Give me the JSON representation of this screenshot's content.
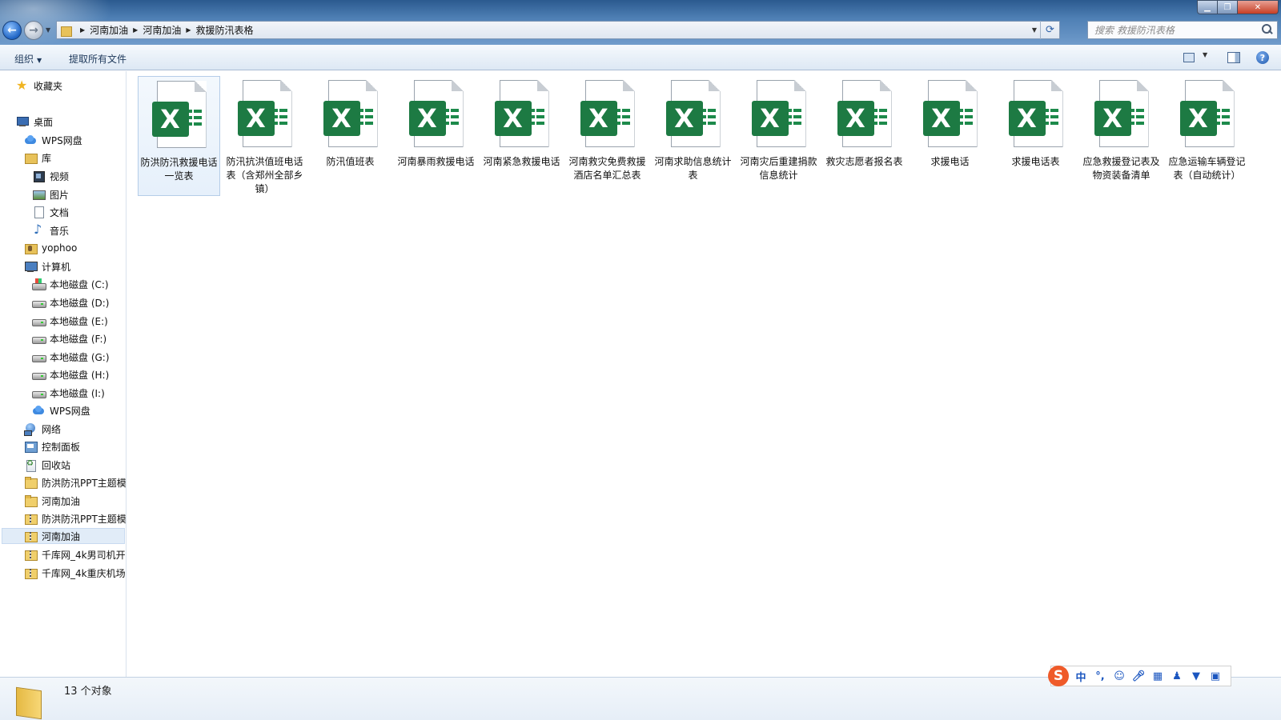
{
  "window": {
    "breadcrumb": [
      "河南加油",
      "河南加油",
      "救援防汛表格"
    ],
    "search_placeholder": "搜索 救援防汛表格"
  },
  "toolbar": {
    "organize": "组织",
    "extract_all": "提取所有文件"
  },
  "sidebar": {
    "items": [
      {
        "label": "收藏夹",
        "icon": "star-icon"
      },
      {
        "label": "桌面",
        "icon": "desktop-icon"
      },
      {
        "label": "WPS网盘",
        "icon": "cloud-icon"
      },
      {
        "label": "库",
        "icon": "library-icon"
      },
      {
        "label": "视频",
        "icon": "video-icon"
      },
      {
        "label": "图片",
        "icon": "picture-icon"
      },
      {
        "label": "文档",
        "icon": "document-icon"
      },
      {
        "label": "音乐",
        "icon": "music-icon"
      },
      {
        "label": "yophoo",
        "icon": "user-folder-icon"
      },
      {
        "label": "计算机",
        "icon": "computer-icon"
      },
      {
        "label": "本地磁盘 (C:)",
        "icon": "system-drive-icon"
      },
      {
        "label": "本地磁盘 (D:)",
        "icon": "drive-icon"
      },
      {
        "label": "本地磁盘 (E:)",
        "icon": "drive-icon"
      },
      {
        "label": "本地磁盘 (F:)",
        "icon": "drive-icon"
      },
      {
        "label": "本地磁盘 (G:)",
        "icon": "drive-icon"
      },
      {
        "label": "本地磁盘 (H:)",
        "icon": "drive-icon"
      },
      {
        "label": "本地磁盘 (I:)",
        "icon": "drive-icon"
      },
      {
        "label": "WPS网盘",
        "icon": "cloud-icon"
      },
      {
        "label": "网络",
        "icon": "network-icon"
      },
      {
        "label": "控制面板",
        "icon": "control-panel-icon"
      },
      {
        "label": "回收站",
        "icon": "recycle-bin-icon"
      },
      {
        "label": "防洪防汛PPT主题模",
        "icon": "folder-icon"
      },
      {
        "label": "河南加油",
        "icon": "folder-icon"
      },
      {
        "label": "防洪防汛PPT主题模",
        "icon": "zip-folder-icon"
      },
      {
        "label": "河南加油",
        "icon": "zip-folder-icon"
      },
      {
        "label": "千库网_4k男司机开:",
        "icon": "zip-folder-icon"
      },
      {
        "label": "千库网_4k重庆机场:",
        "icon": "zip-folder-icon"
      }
    ]
  },
  "files": [
    {
      "name": "防洪防汛救援电话一览表",
      "icon": "excel-file-icon"
    },
    {
      "name": "防汛抗洪值班电话表（含郑州全部乡镇）",
      "icon": "excel-file-icon"
    },
    {
      "name": "防汛值班表",
      "icon": "excel-file-icon"
    },
    {
      "name": "河南暴雨救援电话",
      "icon": "excel-file-icon"
    },
    {
      "name": "河南紧急救援电话",
      "icon": "excel-file-icon"
    },
    {
      "name": "河南救灾免费救援酒店名单汇总表",
      "icon": "excel-file-icon"
    },
    {
      "name": "河南求助信息统计表",
      "icon": "excel-file-icon"
    },
    {
      "name": "河南灾后重建捐款信息统计",
      "icon": "excel-file-icon"
    },
    {
      "name": "救灾志愿者报名表",
      "icon": "excel-file-icon"
    },
    {
      "name": "求援电话",
      "icon": "excel-file-icon"
    },
    {
      "name": "求援电话表",
      "icon": "excel-file-icon"
    },
    {
      "name": "应急救援登记表及物资装备清单",
      "icon": "excel-file-icon"
    },
    {
      "name": "应急运输车辆登记表（自动统计）",
      "icon": "excel-file-icon"
    }
  ],
  "status": {
    "object_count": "13 个对象"
  },
  "ime": {
    "mode": "中",
    "punct": "°,"
  },
  "colors": {
    "excel_green": "#1d7a43",
    "title_bar": "#4e7fb4",
    "selection": "#e1ecf8"
  }
}
